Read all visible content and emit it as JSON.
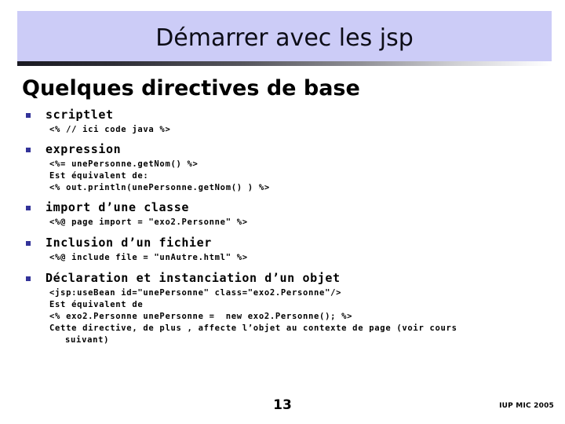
{
  "slide": {
    "title": "Démarrer avec les jsp",
    "heading": "Quelques directives de base",
    "page_number": "13",
    "footer": "IUP MIC 2005",
    "colors": {
      "banner_background": "#ccccf7",
      "bullet_marker": "#333399",
      "title_text": "#0d0d17",
      "body_text": "#000000"
    },
    "blocks": [
      {
        "label": "scriptlet",
        "lines": [
          "<% // ici code java %>"
        ]
      },
      {
        "label": "expression",
        "lines": [
          "<%= unePersonne.getNom() %>",
          "Est équivalent de:",
          "<% out.println(unePersonne.getNom() ) %>"
        ]
      },
      {
        "label": "import d’une classe",
        "lines": [
          "<%@ page import = \"exo2.Personne\" %>"
        ]
      },
      {
        "label": "Inclusion d’un fichier",
        "lines": [
          "<%@ include file = \"unAutre.html\" %>"
        ]
      },
      {
        "label": "Déclaration et instanciation d’un objet",
        "lines": [
          "<jsp:useBean id=\"unePersonne\" class=\"exo2.Personne\"/>",
          "Est équivalent de",
          "<% exo2.Personne unePersonne =  new exo2.Personne(); %>"
        ],
        "wrapped_line": {
          "first": "Cette directive, de plus , affecte l’objet au contexte de page (voir cours",
          "hang": "suivant)"
        }
      }
    ]
  }
}
